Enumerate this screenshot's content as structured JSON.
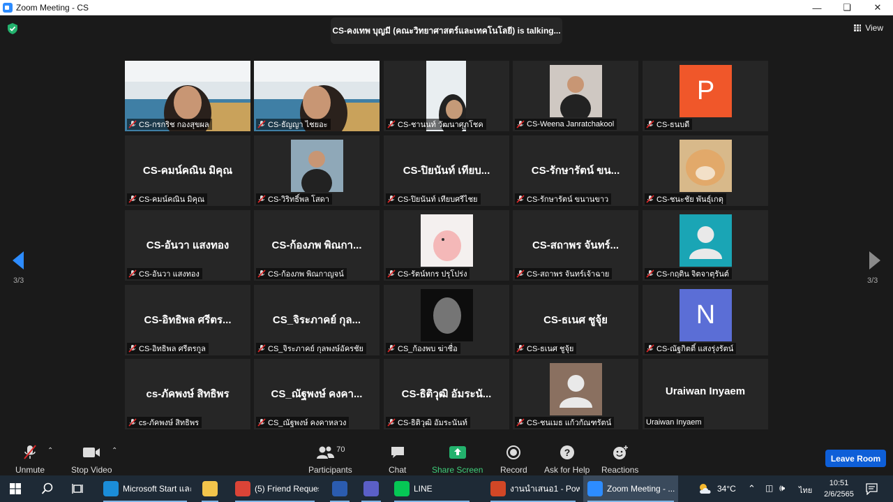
{
  "window": {
    "title": "Zoom Meeting - CS"
  },
  "talking": "CS-คงเทพ บุญมี (คณะวิทยาศาสตร์และเทคโนโลยี) is talking...",
  "view_label": "View",
  "page_left": "3/3",
  "page_right": "3/3",
  "tiles": [
    {
      "label": "CS-กรกริช กองสุขผล",
      "kind": "video"
    },
    {
      "label": "CS-ธัญญา ไชยอะ",
      "kind": "video"
    },
    {
      "label": "CS-ชานนท์ วัฒนาศุภโชค",
      "kind": "video"
    },
    {
      "label": "CS-Weena Janratchakool",
      "kind": "photo"
    },
    {
      "label": "CS-ธนบดี",
      "kind": "letter",
      "letter": "P",
      "color": "#f0572a"
    },
    {
      "label": "CS-คมน์คณิน มิคุณ",
      "kind": "name",
      "bigname": "CS-คมน์คณิน มิคุณ"
    },
    {
      "label": "CS-วิริทธิ์พล โสดา",
      "kind": "photo"
    },
    {
      "label": "CS-ปิยนันท์ เทียบศรีไชย",
      "kind": "name",
      "bigname": "CS-ปิยนันท์ เทียบ..."
    },
    {
      "label": "CS-รักษารัตน์ ขนานขาว",
      "kind": "name",
      "bigname": "CS-รักษารัตน์ ขน..."
    },
    {
      "label": "CS-ชนะชัย พันธุ์เกตุ",
      "kind": "photo"
    },
    {
      "label": "CS-อันวา แสงทอง",
      "kind": "name",
      "bigname": "CS-อันวา แสงทอง"
    },
    {
      "label": "CS-ก้องภพ พิณกาญจน์",
      "kind": "name",
      "bigname": "CS-ก้องภพ พิณกา..."
    },
    {
      "label": "CS-รัตน์ทกร ปรุโปร่ง",
      "kind": "photo"
    },
    {
      "label": "CS-สถาพร จันทร์เจ้าฉาย",
      "kind": "name",
      "bigname": "CS-สถาพร จันทร์..."
    },
    {
      "label": "CS-กฤติน จิตจาตุรันต์",
      "kind": "avatar",
      "color": "#1aa5b5"
    },
    {
      "label": "CS-อิทธิพล ศรีตรกูล",
      "kind": "name",
      "bigname": "CS-อิทธิพล ศรีตร..."
    },
    {
      "label": "CS_จิระภาคย์ กุลพงษ์อัครชัย",
      "kind": "name",
      "bigname": "CS_จิระภาคย์ กุล..."
    },
    {
      "label": "CS_ก้องพบ ฆ่าชื่อ",
      "kind": "photo"
    },
    {
      "label": "CS-ธเนศ ชูจุ้ย",
      "kind": "name",
      "bigname": "CS-ธเนศ ชูจุ้ย"
    },
    {
      "label": "CS-ณัฐกิตติ์ แสงรุ่งรัตน์",
      "kind": "letter",
      "letter": "N",
      "color": "#5b6ed6"
    },
    {
      "label": "cs-ภัคพงษ์ สิทธิพร",
      "kind": "name",
      "bigname": "cs-ภัคพงษ์ สิทธิพร"
    },
    {
      "label": "CS_ณัฐพงษ์ คงคาหลวง",
      "kind": "name",
      "bigname": "CS_ณัฐพงษ์ คงคา..."
    },
    {
      "label": "CS-ธิติวุฒิ อัมระนันท์",
      "kind": "name",
      "bigname": "CS-ธิติวุฒิ อัมระนั..."
    },
    {
      "label": "CS-ชนเมธ แก้วกัณฑรัตน์",
      "kind": "avatar",
      "color": "#8a7060"
    },
    {
      "label": "Uraiwan Inyaem",
      "kind": "name",
      "bigname": "Uraiwan Inyaem",
      "nomic": true
    }
  ],
  "toolbar": {
    "unmute": "Unmute",
    "stop_video": "Stop Video",
    "participants": "Participants",
    "participants_count": "70",
    "chat": "Chat",
    "share": "Share Screen",
    "record": "Record",
    "help": "Ask for Help",
    "reactions": "Reactions",
    "leave": "Leave Room"
  },
  "taskbar": {
    "items": [
      {
        "label": "Microsoft Start และ...",
        "icon": "edge-icon",
        "color": "#1b8dd9"
      },
      {
        "label": "",
        "icon": "folder-icon",
        "color": "#f2c44b"
      },
      {
        "label": "(5) Friend Reques...",
        "icon": "chrome-icon",
        "color": "#db4437"
      },
      {
        "label": "",
        "icon": "word-icon",
        "color": "#2b5cb0"
      },
      {
        "label": "",
        "icon": "teams-icon",
        "color": "#5b5fc7"
      },
      {
        "label": "LINE",
        "icon": "line-icon",
        "color": "#06c755"
      },
      {
        "label": "งานนำเสนอ1 - Pow...",
        "icon": "powerpoint-icon",
        "color": "#d24726"
      },
      {
        "label": "Zoom Meeting - ...",
        "icon": "zoom-icon",
        "color": "#2d8cff"
      }
    ],
    "weather": "34°C",
    "lang": "ไทย",
    "time": "10:51",
    "date": "2/6/2565"
  }
}
